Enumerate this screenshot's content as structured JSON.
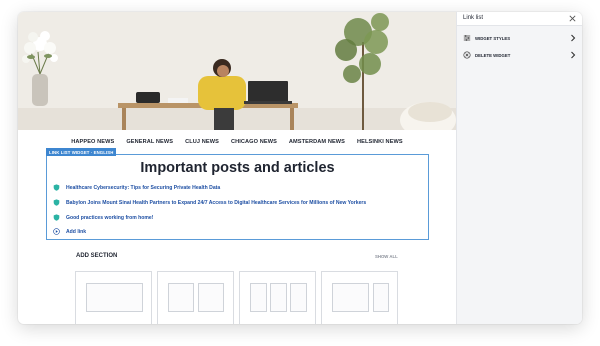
{
  "nav": {
    "items": [
      {
        "label": "HAPPEO NEWS"
      },
      {
        "label": "GENERAL NEWS"
      },
      {
        "label": "CLUJ NEWS"
      },
      {
        "label": "CHICAGO NEWS"
      },
      {
        "label": "AMSTERDAM NEWS"
      },
      {
        "label": "HELSINKI NEWS"
      }
    ]
  },
  "widget": {
    "tag": "LINK LIST WIDGET · ENGLISH",
    "title": "Important posts and articles",
    "links": [
      {
        "label": "Healthcare Cybersecurity: Tips for Securing Private Health Data",
        "icon": "shield-icon"
      },
      {
        "label": "Babylon Joins Mount Sinai Health Partners to Expand 24/7 Access to Digital Healthcare Services for Millions of New Yorkers",
        "icon": "shield-icon"
      },
      {
        "label": "Good practices working from home!",
        "icon": "shield-icon"
      }
    ],
    "add_link": "Add link",
    "accent_color": "#3d86d0",
    "link_color": "#1e4fa3",
    "link_icon_color": "#2bb3a4"
  },
  "add_section": {
    "title": "ADD SECTION",
    "show_all": "SHOW ALL"
  },
  "panel": {
    "title": "Link list",
    "items": [
      {
        "label": "WIDGET STYLES",
        "icon": "sliders-icon"
      },
      {
        "label": "DELETE WIDGET",
        "icon": "delete-circle-icon"
      }
    ]
  }
}
